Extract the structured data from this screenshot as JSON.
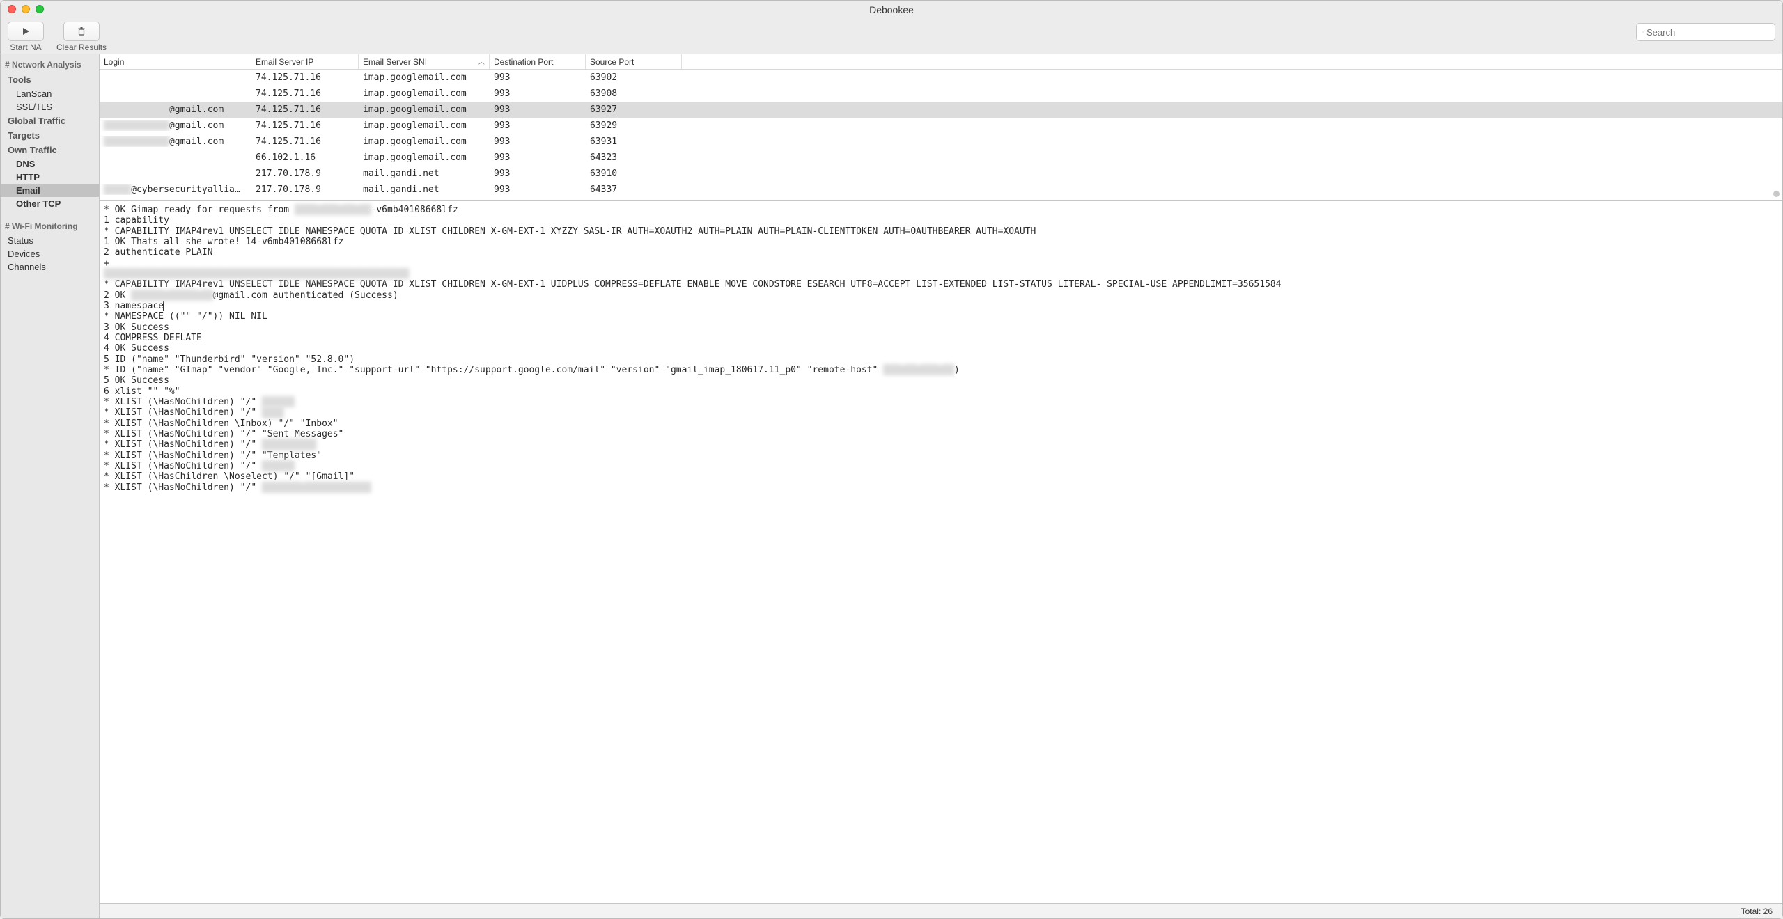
{
  "title": "Debookee",
  "toolbar": {
    "start_label": "Start NA",
    "clear_label": "Clear Results",
    "search_placeholder": "Search"
  },
  "sidebar": {
    "sections": [
      {
        "header": "# Network Analysis",
        "groups": [
          {
            "label": "Tools",
            "items": [
              {
                "label": "LanScan",
                "bold": false,
                "selected": false
              },
              {
                "label": "SSL/TLS",
                "bold": false,
                "selected": false
              }
            ]
          },
          {
            "label": "Global Traffic",
            "items": []
          },
          {
            "label": "Targets",
            "items": []
          },
          {
            "label": "Own Traffic",
            "items": [
              {
                "label": "DNS",
                "bold": true,
                "selected": false
              },
              {
                "label": "HTTP",
                "bold": true,
                "selected": false
              },
              {
                "label": "Email",
                "bold": true,
                "selected": true
              },
              {
                "label": "Other TCP",
                "bold": true,
                "selected": false
              }
            ]
          }
        ]
      },
      {
        "header": "# Wi-Fi Monitoring",
        "groups": [
          {
            "label": null,
            "items": [
              {
                "label": "Status",
                "bold": false,
                "selected": false,
                "indent": 10
              },
              {
                "label": "Devices",
                "bold": false,
                "selected": false,
                "indent": 10
              },
              {
                "label": "Channels",
                "bold": false,
                "selected": false,
                "indent": 10
              }
            ]
          }
        ]
      }
    ]
  },
  "table": {
    "columns": {
      "login": "Login",
      "ip": "Email Server IP",
      "sni": "Email Server SNI",
      "dport": "Destination Port",
      "sport": "Source Port"
    },
    "sort_column": "sni",
    "rows": [
      {
        "login": "",
        "login_blur": false,
        "ip": "74.125.71.16",
        "sni": "imap.googlemail.com",
        "dport": "993",
        "sport": "63902",
        "selected": false
      },
      {
        "login": "",
        "login_blur": false,
        "ip": "74.125.71.16",
        "sni": "imap.googlemail.com",
        "dport": "993",
        "sport": "63908",
        "selected": false
      },
      {
        "login": "████████████",
        "login_blur": true,
        "login_suffix": "@gmail.com",
        "ip": "74.125.71.16",
        "sni": "imap.googlemail.com",
        "dport": "993",
        "sport": "63927",
        "selected": true
      },
      {
        "login": "████████████",
        "login_blur": true,
        "login_suffix": "@gmail.com",
        "ip": "74.125.71.16",
        "sni": "imap.googlemail.com",
        "dport": "993",
        "sport": "63929",
        "selected": false
      },
      {
        "login": "████████████",
        "login_blur": true,
        "login_suffix": "@gmail.com",
        "ip": "74.125.71.16",
        "sni": "imap.googlemail.com",
        "dport": "993",
        "sport": "63931",
        "selected": false
      },
      {
        "login": "",
        "login_blur": false,
        "ip": "66.102.1.16",
        "sni": "imap.googlemail.com",
        "dport": "993",
        "sport": "64323",
        "selected": false
      },
      {
        "login": "",
        "login_blur": false,
        "ip": "217.70.178.9",
        "sni": "mail.gandi.net",
        "dport": "993",
        "sport": "63910",
        "selected": false
      },
      {
        "login": "█████",
        "login_blur": true,
        "login_suffix": "@cybersecurityallia…",
        "ip": "217.70.178.9",
        "sni": "mail.gandi.net",
        "dport": "993",
        "sport": "64337",
        "selected": false
      }
    ]
  },
  "log": {
    "l1a": "* OK Gimap ready for requests from ",
    "l1b": "████ ███ ██ ██",
    "l1c": "-v6mb40108668lfz",
    "l2": "1 capability",
    "l3": "* CAPABILITY IMAP4rev1 UNSELECT IDLE NAMESPACE QUOTA ID XLIST CHILDREN X-GM-EXT-1 XYZZY SASL-IR AUTH=XOAUTH2 AUTH=PLAIN AUTH=PLAIN-CLIENTTOKEN AUTH=OAUTHBEARER AUTH=XOAUTH",
    "l4": "1 OK Thats all she wrote! 14-v6mb40108668lfz",
    "l5": "2 authenticate PLAIN",
    "l6": "+",
    "l7": "████████████████████████████████████████████████████████",
    "l8": "* CAPABILITY IMAP4rev1 UNSELECT IDLE NAMESPACE QUOTA ID XLIST CHILDREN X-GM-EXT-1 UIDPLUS COMPRESS=DEFLATE ENABLE MOVE CONDSTORE ESEARCH UTF8=ACCEPT LIST-EXTENDED LIST-STATUS LITERAL- SPECIAL-USE APPENDLIMIT=35651584",
    "l9a": "2 OK ",
    "l9b": "██████ █████ ██",
    "l9c": "@gmail.com authenticated (Success)",
    "l10": "3 namespace",
    "l11": "* NAMESPACE ((\"\" \"/\")) NIL NIL",
    "l12": "3 OK Success",
    "l13": "4 COMPRESS DEFLATE",
    "l14": "4 OK Success",
    "l15": "5 ID (\"name\" \"Thunderbird\" \"version\" \"52.8.0\")",
    "l16a": "* ID (\"name\" \"GImap\" \"vendor\" \"Google, Inc.\" \"support-url\" \"https://support.google.com/mail\" \"version\" \"gmail_imap_180617.11_p0\" \"remote-host\" ",
    "l16b": "███ ██ ███ ██",
    "l16c": ")",
    "l17": "5 OK Success",
    "l18": "6 xlist \"\" \"%\"",
    "l19a": "* XLIST (\\HasNoChildren) \"/\" ",
    "l19b": "██████",
    "l20a": "* XLIST (\\HasNoChildren) \"/\" ",
    "l20b": "████",
    "l21": "* XLIST (\\HasNoChildren \\Inbox) \"/\" \"Inbox\"",
    "l22": "* XLIST (\\HasNoChildren) \"/\" \"Sent Messages\"",
    "l23a": "* XLIST (\\HasNoChildren) \"/\" ",
    "l23b": "██████████",
    "l24": "* XLIST (\\HasNoChildren) \"/\" \"Templates\"",
    "l25a": "* XLIST (\\HasNoChildren) \"/\" ",
    "l25b": "██████",
    "l26": "* XLIST (\\HasChildren \\Noselect) \"/\" \"[Gmail]\"",
    "l27a": "* XLIST (\\HasNoChildren) \"/\" ",
    "l27b": "███████ ████████████"
  },
  "status": {
    "total_label": "Total: 26"
  }
}
